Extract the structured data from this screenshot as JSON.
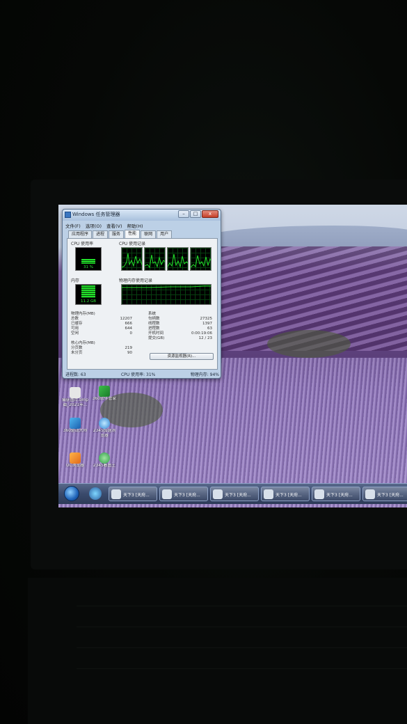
{
  "window": {
    "title": "Windows 任务管理器",
    "caption_min": "–",
    "caption_max": "□",
    "caption_close": "x"
  },
  "menu": [
    "文件(F)",
    "选项(O)",
    "查看(V)",
    "帮助(H)"
  ],
  "tabs": [
    "应用程序",
    "进程",
    "服务",
    "性能",
    "联网",
    "用户"
  ],
  "active_tab": "性能",
  "performance": {
    "cpu_usage_label": "CPU 使用率",
    "cpu_usage_value": "31 %",
    "cpu_usage_level": 0.31,
    "cpu_history_label": "CPU 使用记录",
    "memory_label": "内存",
    "memory_value": "11.2 GB",
    "memory_level": 0.94,
    "memory_history_label": "物理内存使用记录"
  },
  "physical_memory": {
    "title": "物理内存(MB)",
    "rows": [
      {
        "label": "总数",
        "value": "12207"
      },
      {
        "label": "已缓存",
        "value": "666"
      },
      {
        "label": "可用",
        "value": "644"
      },
      {
        "label": "空闲",
        "value": "0"
      }
    ]
  },
  "kernel_memory": {
    "title": "核心内存(MB)",
    "rows": [
      {
        "label": "分页数",
        "value": "219"
      },
      {
        "label": "未分页",
        "value": "90"
      }
    ]
  },
  "system": {
    "title": "系统",
    "rows": [
      {
        "label": "句柄数",
        "value": "27325"
      },
      {
        "label": "线程数",
        "value": "1397"
      },
      {
        "label": "进程数",
        "value": "63"
      },
      {
        "label": "开机时间",
        "value": "0:00:19:06"
      },
      {
        "label": "提交(GB)",
        "value": "12 / 23"
      }
    ]
  },
  "resource_monitor_button": "资源监视器(R)...",
  "status": {
    "processes": "进程数: 63",
    "cpu": "CPU 使用率: 31%",
    "memory": "物理内存: 94%"
  },
  "desktop_icons": [
    {
      "label": "捕获图片.bmp",
      "label2": "截_2021年..."
    },
    {
      "label": "360软件管家",
      "label2": ""
    },
    {
      "label": "360驱动大师",
      "label2": ""
    },
    {
      "label": "2345加速浏",
      "label2": "览器"
    },
    {
      "label": "UC浏览器",
      "label2": ""
    },
    {
      "label": "2345看图王",
      "label2": ""
    }
  ],
  "taskbar_items": [
    "天下3 [天府...",
    "天下3 [天府...",
    "天下3 [天府...",
    "天下3 [天府...",
    "天下3 [天府...",
    "天下3 [天府..."
  ],
  "colors": {
    "graph_green": "#22e02a",
    "window_frame": "#bcd0e6",
    "taskbar": "#3a4a6c"
  }
}
